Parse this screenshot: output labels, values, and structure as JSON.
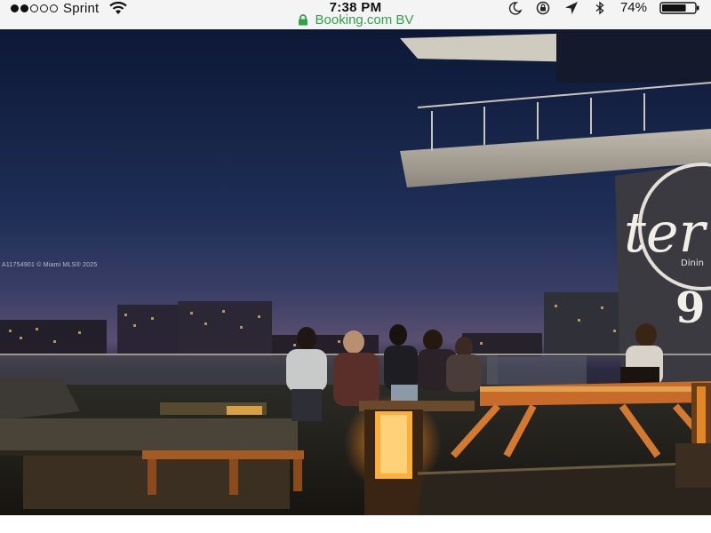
{
  "status_bar": {
    "signal_dots_filled": 2,
    "signal_dots_total": 5,
    "carrier": "Sprint",
    "time": "7:38 PM",
    "url": "Booking.com BV",
    "battery": "74%",
    "battery_level": 0.74,
    "icons": [
      "wifi-icon",
      "moon-icon",
      "rotation-lock-icon",
      "location-arrow-icon",
      "bluetooth-icon",
      "battery-icon"
    ]
  },
  "photo": {
    "watermark": "A11754901 © Miami MLS® 2025",
    "sign_text": "ter",
    "sign_sub": "Dinin",
    "sign_number": "9"
  },
  "colors": {
    "url_green": "#2fa34a",
    "sky_top": "#0d1836",
    "sky_horizon": "#5a4f70",
    "lamp_glow": "#ffae3a"
  }
}
